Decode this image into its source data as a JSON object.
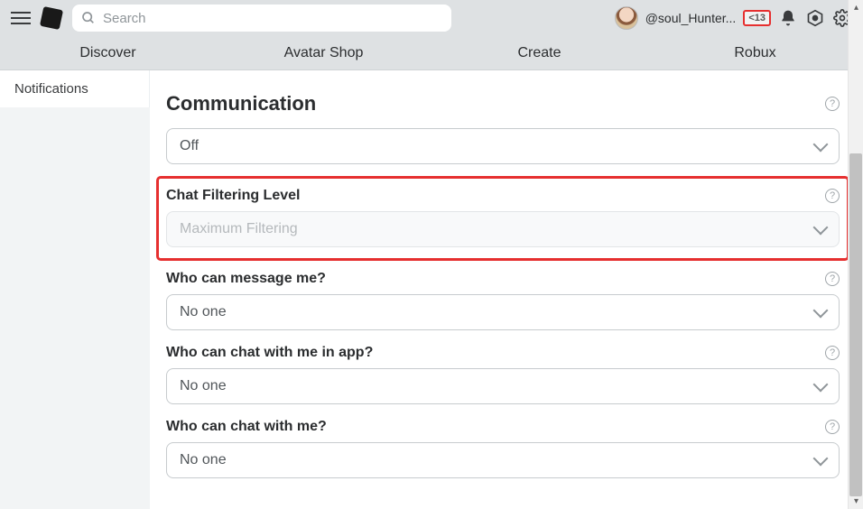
{
  "topbar": {
    "search_placeholder": "Search",
    "username": "@soul_Hunter...",
    "age_badge": "<13"
  },
  "nav": {
    "items": [
      "Discover",
      "Avatar Shop",
      "Create",
      "Robux"
    ]
  },
  "sidebar": {
    "items": [
      {
        "label": "Notifications"
      }
    ]
  },
  "section": {
    "title": "Communication"
  },
  "settings": [
    {
      "label": "",
      "value": "Off",
      "highlighted": false,
      "disabled": false,
      "has_label": false
    },
    {
      "label": "Chat Filtering Level",
      "value": "Maximum Filtering",
      "highlighted": true,
      "disabled": true,
      "has_label": true
    },
    {
      "label": "Who can message me?",
      "value": "No one",
      "highlighted": false,
      "disabled": false,
      "has_label": true
    },
    {
      "label": "Who can chat with me in app?",
      "value": "No one",
      "highlighted": false,
      "disabled": false,
      "has_label": true
    },
    {
      "label": "Who can chat with me?",
      "value": "No one",
      "highlighted": false,
      "disabled": false,
      "has_label": true
    }
  ]
}
